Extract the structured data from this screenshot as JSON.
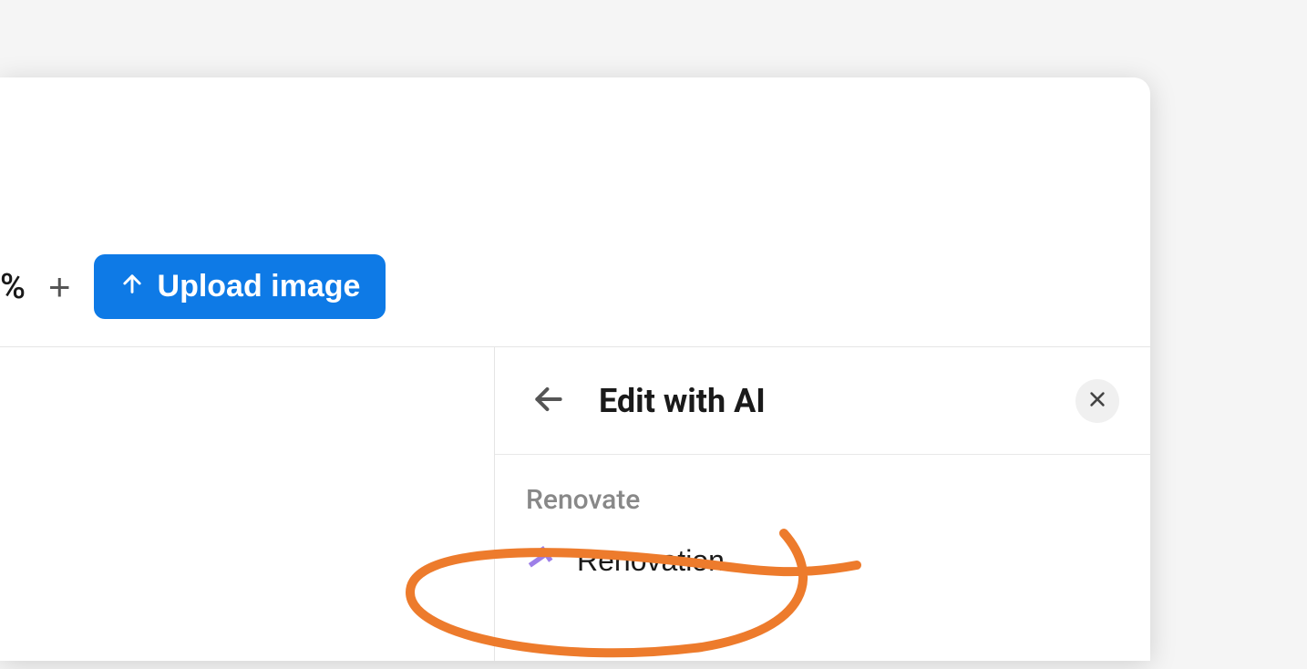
{
  "toolbar": {
    "percent_symbol": "%",
    "plus_symbol": "+",
    "upload_label": "Upload image"
  },
  "panel": {
    "title": "Edit with AI",
    "section_label": "Renovate",
    "items": [
      {
        "label": "Renovation",
        "icon_name": "hammer-icon",
        "icon_color": "#9d7fe8"
      }
    ]
  },
  "colors": {
    "primary_button": "#0e7ae6",
    "annotation": "#ed7b2c",
    "icon_accent": "#9d7fe8"
  }
}
